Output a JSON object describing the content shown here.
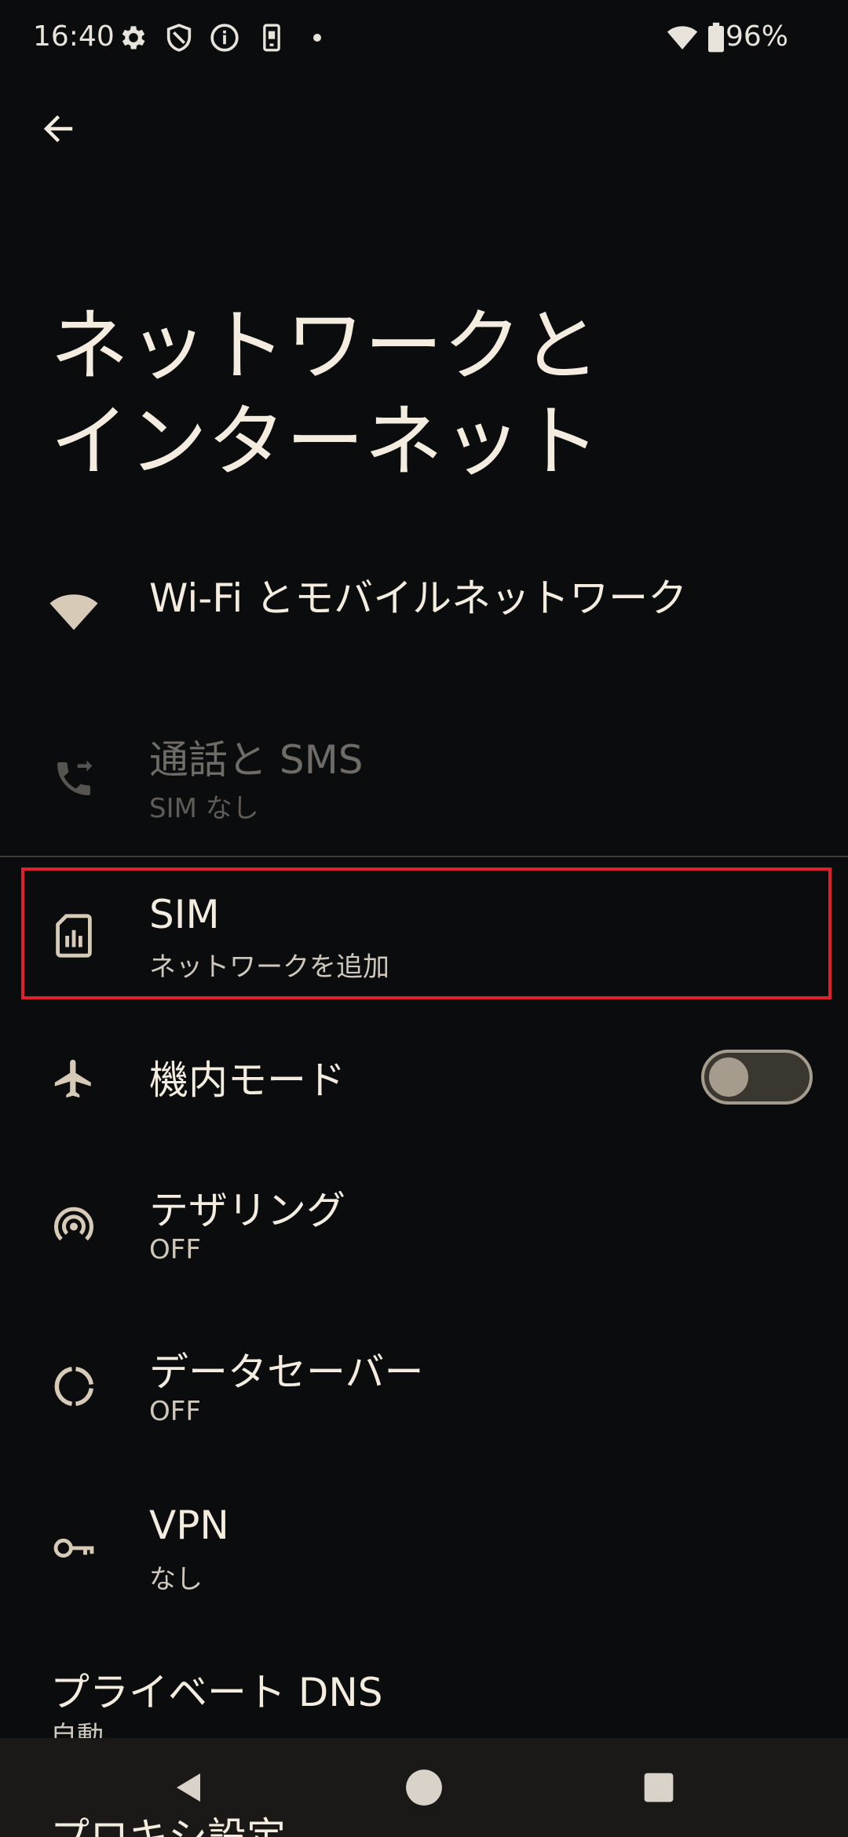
{
  "status_bar": {
    "time": "16:40",
    "battery": "96%",
    "icons": [
      "gear-icon",
      "shield-icon",
      "info-icon",
      "phone-sim-icon",
      "dot-icon",
      "wifi-icon",
      "battery-icon"
    ]
  },
  "header": {
    "back_icon": "arrow-left-icon",
    "title": "ネットワークと\nインターネット"
  },
  "items": [
    {
      "title": "Wi-Fi とモバイルネットワーク",
      "subtitle": "",
      "icon": "wifi-icon",
      "enabled": true
    },
    {
      "title": "通話と SMS",
      "subtitle": "SIM なし",
      "icon": "phone-forward-icon",
      "enabled": false
    },
    {
      "title": "SIM",
      "subtitle": "ネットワークを追加",
      "icon": "sim-card-icon",
      "enabled": true
    },
    {
      "title": "機内モード",
      "subtitle": "",
      "icon": "airplane-icon",
      "enabled": true,
      "toggle_on": false
    },
    {
      "title": "テザリング",
      "subtitle": "OFF",
      "icon": "hotspot-icon",
      "enabled": true
    },
    {
      "title": "データセーバー",
      "subtitle": "OFF",
      "icon": "data-saver-icon",
      "enabled": true
    },
    {
      "title": "VPN",
      "subtitle": "なし",
      "icon": "key-icon",
      "enabled": true
    },
    {
      "title": "プライベート DNS",
      "subtitle": "自動",
      "icon": "",
      "enabled": true
    },
    {
      "title": "プロキシ設定",
      "subtitle": "",
      "icon": "",
      "enabled": true
    }
  ],
  "navigation": {
    "icons": [
      "nav-back-icon",
      "nav-home-icon",
      "nav-recents-icon"
    ]
  },
  "colors": {
    "background": "#0b0c0e",
    "text_primary": "#f4ecdf",
    "text_secondary": "#cfc7bb",
    "icon": "#d7cbb8",
    "highlight_border": "#e0202a",
    "nav_bar": "#1a1917"
  }
}
